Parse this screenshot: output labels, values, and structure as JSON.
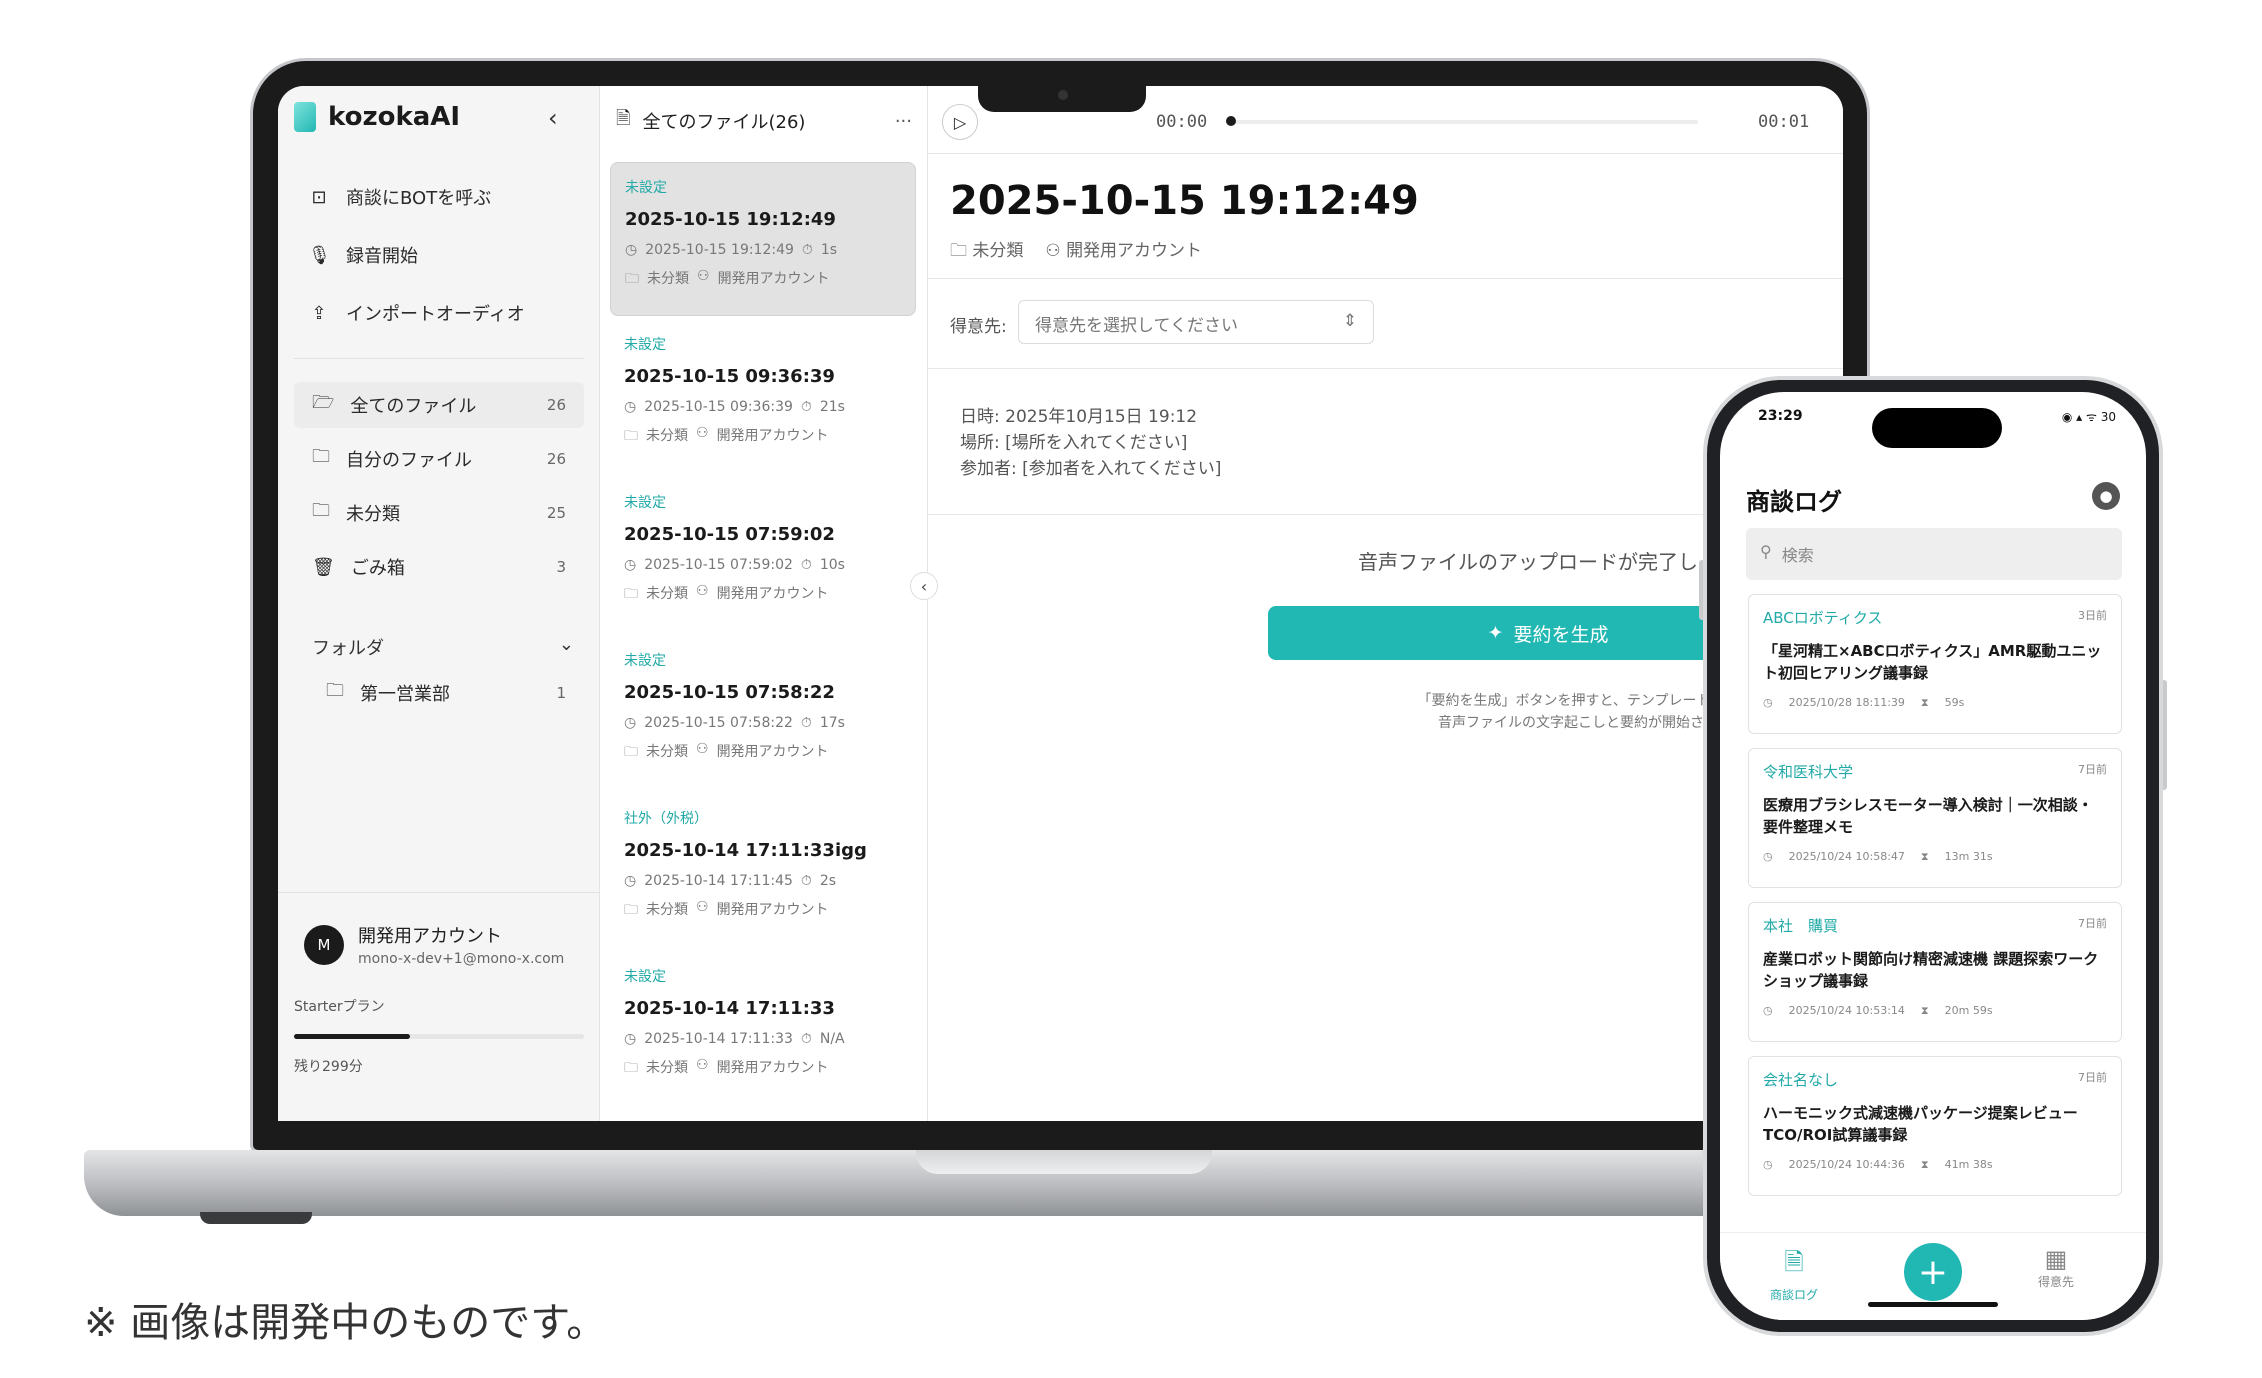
{
  "laptop": {
    "app": {
      "logo": "kozokaAI",
      "collapse": "‹"
    },
    "actions": [
      {
        "icon": "bot-icon",
        "glyph": "⊡",
        "label": "商談にBOTを呼ぶ"
      },
      {
        "icon": "mic-icon",
        "glyph": "🎙",
        "label": "録音開始"
      },
      {
        "icon": "upload-icon",
        "glyph": "⇪",
        "label": "インポートオーディオ"
      }
    ],
    "nav": [
      {
        "label": "全てのファイル",
        "count": "26",
        "active": true
      },
      {
        "label": "自分のファイル",
        "count": "26"
      },
      {
        "label": "未分類",
        "count": "25"
      },
      {
        "label": "ごみ箱",
        "count": "3"
      }
    ],
    "folders": {
      "heading": "フォルダ",
      "items": [
        {
          "label": "第一営業部",
          "count": "1"
        }
      ]
    },
    "account": {
      "initial": "M",
      "name": "開発用アカウント",
      "email": "mono-x-dev+1@mono-x.com",
      "plan": "Starterプラン",
      "remaining": "残り299分",
      "usage_fraction": 0.4
    },
    "file_list": {
      "heading": "全てのファイル(26)",
      "more": "···",
      "items": [
        {
          "tag": "未設定",
          "title": "2025-10-15 19:12:49",
          "datetime": "2025-10-15 19:12:49",
          "duration": "1s",
          "folder": "未分類",
          "owner": "開発用アカウント",
          "selected": true
        },
        {
          "tag": "未設定",
          "title": "2025-10-15 09:36:39",
          "datetime": "2025-10-15 09:36:39",
          "duration": "21s",
          "folder": "未分類",
          "owner": "開発用アカウント"
        },
        {
          "tag": "未設定",
          "title": "2025-10-15 07:59:02",
          "datetime": "2025-10-15 07:59:02",
          "duration": "10s",
          "folder": "未分類",
          "owner": "開発用アカウント"
        },
        {
          "tag": "未設定",
          "title": "2025-10-15 07:58:22",
          "datetime": "2025-10-15 07:58:22",
          "duration": "17s",
          "folder": "未分類",
          "owner": "開発用アカウント"
        },
        {
          "tag": "社外（外税）",
          "title": "2025-10-14 17:11:33igg",
          "datetime": "2025-10-14 17:11:45",
          "duration": "2s",
          "folder": "未分類",
          "owner": "開発用アカウント"
        },
        {
          "tag": "未設定",
          "title": "2025-10-14 17:11:33",
          "datetime": "2025-10-14 17:11:33",
          "duration": "N/A",
          "folder": "未分類",
          "owner": "開発用アカウント"
        }
      ]
    },
    "player": {
      "current": "00:00",
      "total": "00:01",
      "progress_fraction": 0.0
    },
    "detail": {
      "title": "2025-10-15 19:12:49",
      "folder": "未分類",
      "owner": "開発用アカウント",
      "customer_label": "得意先:",
      "customer_placeholder": "得意先を選択してください",
      "date_line": "日時: 2025年10月15日 19:12",
      "place_line": "場所: [場所を入れてください]",
      "attendees_line": "参加者: [参加者を入れてください]",
      "upload_message": "音声ファイルのアップロードが完了し",
      "generate_button": "要約を生成",
      "hint1": "「要約を生成」ボタンを押すと、テンプレートを選",
      "hint2": "音声ファイルの文字起こしと要約が開始され"
    }
  },
  "phone": {
    "status_time": "23:29",
    "status_right": "◉ ▴ ᯤ 30",
    "title": "商談ログ",
    "search_placeholder": "検索",
    "cards": [
      {
        "company": "ABCロボティクス",
        "ago": "3日前",
        "title": "「星河精工×ABCロボティクス」AMR駆動ユニット初回ヒアリング議事録",
        "datetime": "2025/10/28 18:11:39",
        "duration": "59s"
      },
      {
        "company": "令和医科大学",
        "ago": "7日前",
        "title": "医療用ブラシレスモーター導入検討｜一次相談・要件整理メモ",
        "datetime": "2025/10/24 10:58:47",
        "duration": "13m 31s"
      },
      {
        "company": "本社　購買",
        "ago": "7日前",
        "title": "産業ロボット関節向け精密減速機 課題探索ワークショップ議事録",
        "datetime": "2025/10/24 10:53:14",
        "duration": "20m 59s"
      },
      {
        "company": "会社名なし",
        "ago": "7日前",
        "title": "ハーモニック式減速機パッケージ提案レビュー TCO/ROI試算議事録",
        "datetime": "2025/10/24 10:44:36",
        "duration": "41m 38s"
      }
    ],
    "tabs": {
      "log": "商談ログ",
      "add": "+",
      "customers": "得意先"
    }
  },
  "note": "※ 画像は開発中のものです。",
  "colors": {
    "accent": "#21b7b3",
    "tag": "#22aaa8"
  }
}
